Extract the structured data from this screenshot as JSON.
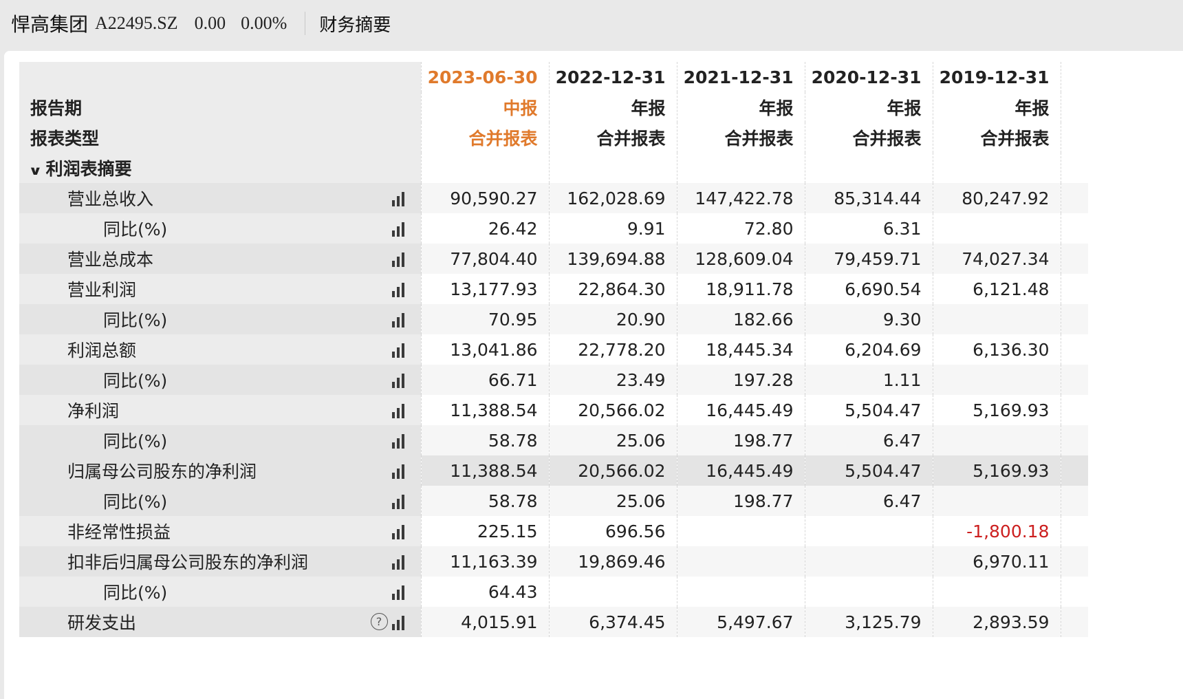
{
  "header": {
    "company": "悍高集团",
    "ticker": "A22495.SZ",
    "change": "0.00",
    "change_pct": "0.00%",
    "section_tab": "财务摘要"
  },
  "table": {
    "header_labels": {
      "period": "报告期",
      "type": "报表类型"
    },
    "columns": [
      {
        "date": "2023-06-30",
        "period_type": "中报",
        "report_type": "合并报表",
        "highlight": true
      },
      {
        "date": "2022-12-31",
        "period_type": "年报",
        "report_type": "合并报表"
      },
      {
        "date": "2021-12-31",
        "period_type": "年报",
        "report_type": "合并报表"
      },
      {
        "date": "2020-12-31",
        "period_type": "年报",
        "report_type": "合并报表"
      },
      {
        "date": "2019-12-31",
        "period_type": "年报",
        "report_type": "合并报表"
      }
    ],
    "section": "利润表摘要",
    "rows": [
      {
        "label": "营业总收入",
        "indent": 1,
        "values": [
          "90,590.27",
          "162,028.69",
          "147,422.78",
          "85,314.44",
          "80,247.92"
        ]
      },
      {
        "label": "同比(%)",
        "indent": 2,
        "values": [
          "26.42",
          "9.91",
          "72.80",
          "6.31",
          ""
        ]
      },
      {
        "label": "营业总成本",
        "indent": 1,
        "values": [
          "77,804.40",
          "139,694.88",
          "128,609.04",
          "79,459.71",
          "74,027.34"
        ]
      },
      {
        "label": "营业利润",
        "indent": 1,
        "values": [
          "13,177.93",
          "22,864.30",
          "18,911.78",
          "6,690.54",
          "6,121.48"
        ]
      },
      {
        "label": "同比(%)",
        "indent": 2,
        "values": [
          "70.95",
          "20.90",
          "182.66",
          "9.30",
          ""
        ]
      },
      {
        "label": "利润总额",
        "indent": 1,
        "values": [
          "13,041.86",
          "22,778.20",
          "18,445.34",
          "6,204.69",
          "6,136.30"
        ]
      },
      {
        "label": "同比(%)",
        "indent": 2,
        "values": [
          "66.71",
          "23.49",
          "197.28",
          "1.11",
          ""
        ]
      },
      {
        "label": "净利润",
        "indent": 1,
        "values": [
          "11,388.54",
          "20,566.02",
          "16,445.49",
          "5,504.47",
          "5,169.93"
        ]
      },
      {
        "label": "同比(%)",
        "indent": 2,
        "values": [
          "58.78",
          "25.06",
          "198.77",
          "6.47",
          ""
        ]
      },
      {
        "label": "归属母公司股东的净利润",
        "indent": 1,
        "hover": true,
        "values": [
          "11,388.54",
          "20,566.02",
          "16,445.49",
          "5,504.47",
          "5,169.93"
        ]
      },
      {
        "label": "同比(%)",
        "indent": 2,
        "values": [
          "58.78",
          "25.06",
          "198.77",
          "6.47",
          ""
        ]
      },
      {
        "label": "非经常性损益",
        "indent": 1,
        "values": [
          "225.15",
          "696.56",
          "",
          "",
          "-1,800.18"
        ]
      },
      {
        "label": "扣非后归属母公司股东的净利润",
        "indent": 1,
        "values": [
          "11,163.39",
          "19,869.46",
          "",
          "",
          "6,970.11"
        ]
      },
      {
        "label": "同比(%)",
        "indent": 2,
        "values": [
          "64.43",
          "",
          "",
          "",
          ""
        ]
      },
      {
        "label": "研发支出",
        "indent": 1,
        "help": true,
        "values": [
          "4,015.91",
          "6,374.45",
          "5,497.67",
          "3,125.79",
          "2,893.59"
        ]
      }
    ]
  },
  "colors": {
    "highlight_orange": "#e07a2c",
    "negative_red": "#cc1f1f"
  },
  "icons": {
    "chart": "bar-chart-icon",
    "help": "question-circle-icon",
    "collapse": "chevron-down-icon"
  }
}
